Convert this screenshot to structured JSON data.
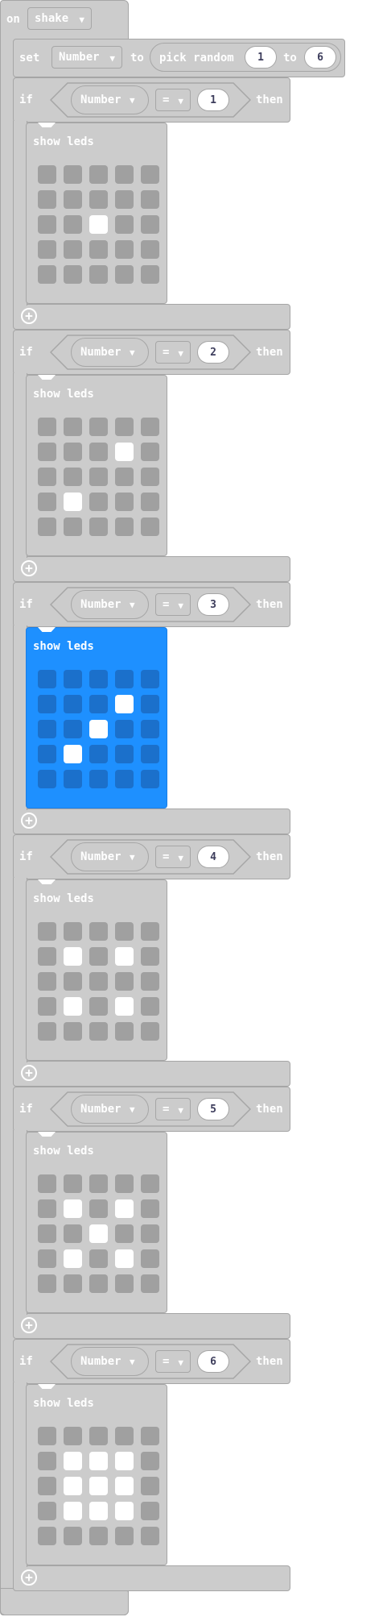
{
  "event": {
    "keyword": "on",
    "gesture": "shake"
  },
  "set_block": {
    "keyword": "set",
    "variable": "Number",
    "to_label": "to",
    "random_label": "pick random",
    "from": "1",
    "to2_label": "to",
    "max": "6"
  },
  "if_blocks": [
    {
      "if_label": "if",
      "variable": "Number",
      "operator": "=",
      "value": "1",
      "then_label": "then",
      "leds_title": "show leds",
      "leds": [
        [
          0,
          0,
          0,
          0,
          0
        ],
        [
          0,
          0,
          0,
          0,
          0
        ],
        [
          0,
          0,
          1,
          0,
          0
        ],
        [
          0,
          0,
          0,
          0,
          0
        ],
        [
          0,
          0,
          0,
          0,
          0
        ]
      ]
    },
    {
      "if_label": "if",
      "variable": "Number",
      "operator": "=",
      "value": "2",
      "then_label": "then",
      "leds_title": "show leds",
      "leds": [
        [
          0,
          0,
          0,
          0,
          0
        ],
        [
          0,
          0,
          0,
          1,
          0
        ],
        [
          0,
          0,
          0,
          0,
          0
        ],
        [
          0,
          1,
          0,
          0,
          0
        ],
        [
          0,
          0,
          0,
          0,
          0
        ]
      ]
    },
    {
      "if_label": "if",
      "variable": "Number",
      "operator": "=",
      "value": "3",
      "then_label": "then",
      "leds_title": "show leds",
      "selected": true,
      "leds": [
        [
          0,
          0,
          0,
          0,
          0
        ],
        [
          0,
          0,
          0,
          1,
          0
        ],
        [
          0,
          0,
          1,
          0,
          0
        ],
        [
          0,
          1,
          0,
          0,
          0
        ],
        [
          0,
          0,
          0,
          0,
          0
        ]
      ]
    },
    {
      "if_label": "if",
      "variable": "Number",
      "operator": "=",
      "value": "4",
      "then_label": "then",
      "leds_title": "show leds",
      "leds": [
        [
          0,
          0,
          0,
          0,
          0
        ],
        [
          0,
          1,
          0,
          1,
          0
        ],
        [
          0,
          0,
          0,
          0,
          0
        ],
        [
          0,
          1,
          0,
          1,
          0
        ],
        [
          0,
          0,
          0,
          0,
          0
        ]
      ]
    },
    {
      "if_label": "if",
      "variable": "Number",
      "operator": "=",
      "value": "5",
      "then_label": "then",
      "leds_title": "show leds",
      "leds": [
        [
          0,
          0,
          0,
          0,
          0
        ],
        [
          0,
          1,
          0,
          1,
          0
        ],
        [
          0,
          0,
          1,
          0,
          0
        ],
        [
          0,
          1,
          0,
          1,
          0
        ],
        [
          0,
          0,
          0,
          0,
          0
        ]
      ]
    },
    {
      "if_label": "if",
      "variable": "Number",
      "operator": "=",
      "value": "6",
      "then_label": "then",
      "leds_title": "show leds",
      "leds": [
        [
          0,
          0,
          0,
          0,
          0
        ],
        [
          0,
          1,
          1,
          1,
          0
        ],
        [
          0,
          1,
          1,
          1,
          0
        ],
        [
          0,
          1,
          1,
          1,
          0
        ],
        [
          0,
          0,
          0,
          0,
          0
        ]
      ]
    }
  ],
  "colors": {
    "block": "#cccccc",
    "selected": "#1e90ff",
    "led_off": "#a0a0a0",
    "led_on": "#ffffff"
  }
}
